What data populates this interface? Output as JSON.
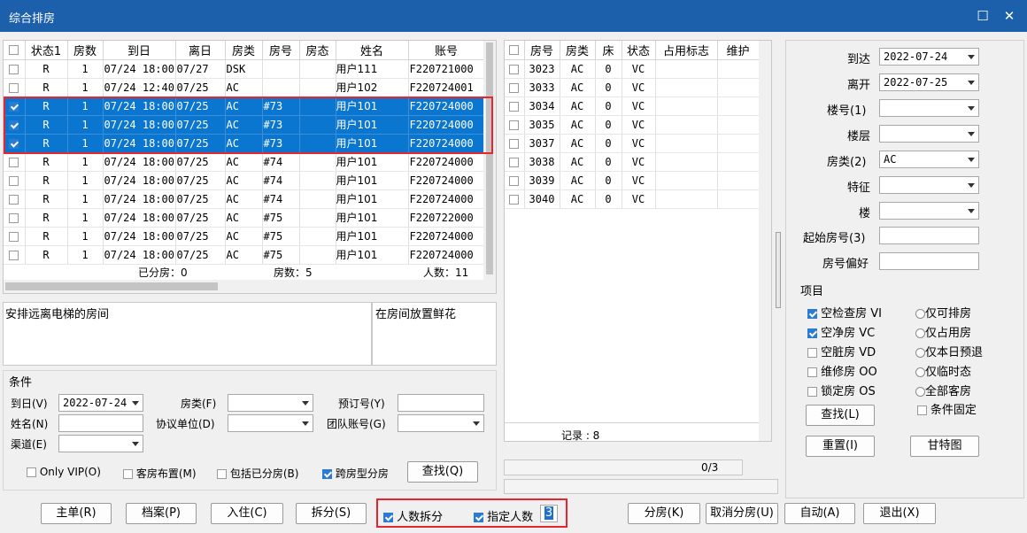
{
  "window": {
    "title": "综合排房",
    "max_glyph": "☐",
    "close_glyph": "✕"
  },
  "left_grid": {
    "headers": [
      "状态1",
      "房数",
      "到日",
      "离日",
      "房类",
      "房号",
      "房态",
      "姓名",
      "账号"
    ],
    "rows": [
      {
        "checked": false,
        "selected": false,
        "cells": [
          "R",
          "1",
          "07/24 18:00",
          "07/27",
          "DSK",
          "",
          "",
          "用户111",
          "F220721000"
        ]
      },
      {
        "checked": false,
        "selected": false,
        "cells": [
          "R",
          "1",
          "07/24 12:40",
          "07/25",
          "AC",
          "",
          "",
          "用户102",
          "F220724001"
        ]
      },
      {
        "checked": true,
        "selected": true,
        "cells": [
          "R",
          "1",
          "07/24 18:00",
          "07/25",
          "AC",
          "#73",
          "",
          "用户101",
          "F220724000"
        ]
      },
      {
        "checked": true,
        "selected": true,
        "cells": [
          "R",
          "1",
          "07/24 18:00",
          "07/25",
          "AC",
          "#73",
          "",
          "用户101",
          "F220724000"
        ]
      },
      {
        "checked": true,
        "selected": true,
        "cells": [
          "R",
          "1",
          "07/24 18:00",
          "07/25",
          "AC",
          "#73",
          "",
          "用户101",
          "F220724000"
        ]
      },
      {
        "checked": false,
        "selected": false,
        "cells": [
          "R",
          "1",
          "07/24 18:00",
          "07/25",
          "AC",
          "#74",
          "",
          "用户101",
          "F220724000"
        ]
      },
      {
        "checked": false,
        "selected": false,
        "cells": [
          "R",
          "1",
          "07/24 18:00",
          "07/25",
          "AC",
          "#74",
          "",
          "用户101",
          "F220724000"
        ]
      },
      {
        "checked": false,
        "selected": false,
        "cells": [
          "R",
          "1",
          "07/24 18:00",
          "07/25",
          "AC",
          "#74",
          "",
          "用户101",
          "F220724000"
        ]
      },
      {
        "checked": false,
        "selected": false,
        "cells": [
          "R",
          "1",
          "07/24 18:00",
          "07/25",
          "AC",
          "#75",
          "",
          "用户101",
          "F220722000"
        ]
      },
      {
        "checked": false,
        "selected": false,
        "cells": [
          "R",
          "1",
          "07/24 18:00",
          "07/25",
          "AC",
          "#75",
          "",
          "用户101",
          "F220724000"
        ]
      },
      {
        "checked": false,
        "selected": false,
        "cells": [
          "R",
          "1",
          "07/24 18:00",
          "07/25",
          "AC",
          "#75",
          "",
          "用户101",
          "F220724000"
        ]
      }
    ],
    "summary": {
      "assigned": "已分房：0",
      "rooms": "房数：5",
      "persons": "人数：11"
    }
  },
  "notes": {
    "left": "安排远离电梯的房间",
    "right": "在房间放置鲜花"
  },
  "conditions": {
    "legend": "条件",
    "arrive_label": "到日(V)",
    "arrive_value": "2022-07-24",
    "roomtype_label": "房类(F)",
    "roomtype_value": "",
    "booking_label": "预订号(Y)",
    "name_label": "姓名(N)",
    "company_label": "协议单位(D)",
    "group_label": "团队账号(G)",
    "channel_label": "渠道(E)",
    "only_vip": "Only VIP(O)",
    "room_layout": "客房布置(M)",
    "include_assigned": "包括已分房(B)",
    "cross_type": "跨房型分房",
    "search_btn": "查找(Q)"
  },
  "right_grid": {
    "headers": [
      "房号",
      "房类",
      "床",
      "状态",
      "占用标志",
      "维护"
    ],
    "rows": [
      [
        "3023",
        "AC",
        "0",
        "VC",
        ""
      ],
      [
        "3033",
        "AC",
        "0",
        "VC",
        ""
      ],
      [
        "3034",
        "AC",
        "0",
        "VC",
        ""
      ],
      [
        "3035",
        "AC",
        "0",
        "VC",
        ""
      ],
      [
        "3037",
        "AC",
        "0",
        "VC",
        ""
      ],
      [
        "3038",
        "AC",
        "0",
        "VC",
        ""
      ],
      [
        "3039",
        "AC",
        "0",
        "VC",
        ""
      ],
      [
        "3040",
        "AC",
        "0",
        "VC",
        ""
      ]
    ],
    "records": "记录 : 8",
    "progress_text": "0/3"
  },
  "filter": {
    "arrive_label": "到达",
    "arrive_value": "2022-07-24",
    "depart_label": "离开",
    "depart_value": "2022-07-25",
    "building_label": "楼号(1)",
    "floor_label": "楼层",
    "roomtype_label": "房类(2)",
    "roomtype_value": "AC",
    "feature_label": "特征",
    "tower_label": "楼",
    "start_room_label": "起始房号(3)",
    "pref_label": "房号偏好",
    "items_label": "项目",
    "checks": [
      {
        "label": "空检查房 VI",
        "on": true
      },
      {
        "label": "空净房 VC",
        "on": true
      },
      {
        "label": "空脏房 VD",
        "on": false
      },
      {
        "label": "维修房 OO",
        "on": false
      },
      {
        "label": "锁定房 OS",
        "on": false
      }
    ],
    "radios": [
      "仅可排房",
      "仅占用房",
      "仅本日预退",
      "仅临时态",
      "全部客房"
    ],
    "fixed_label": "条件固定",
    "search_btn": "查找(L)",
    "reset_btn": "重置(I)",
    "gantt_btn": "甘特图"
  },
  "bottom": {
    "main_btn": "主单(R)",
    "profile_btn": "档案(P)",
    "checkin_btn": "入住(C)",
    "split_btn": "拆分(S)",
    "person_split": "人数拆分",
    "assign_count_label": "指定人数",
    "assign_count_value": "3",
    "assign_btn": "分房(K)",
    "cancel_assign_btn": "取消分房(U)",
    "auto_btn": "自动(A)",
    "exit_btn": "退出(X)"
  }
}
